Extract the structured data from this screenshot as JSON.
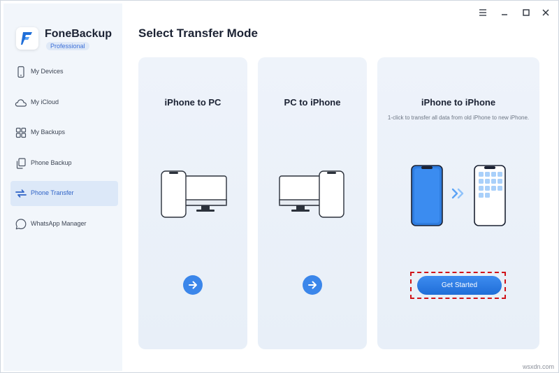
{
  "app": {
    "name": "FoneBackup",
    "tier": "Professional"
  },
  "sidebar": {
    "items": [
      {
        "label": "My Devices",
        "icon": "phone-icon",
        "active": false
      },
      {
        "label": "My iCloud",
        "icon": "cloud-icon",
        "active": false
      },
      {
        "label": "My Backups",
        "icon": "grid-icon",
        "active": false
      },
      {
        "label": "Phone Backup",
        "icon": "copy-icon",
        "active": false
      },
      {
        "label": "Phone Transfer",
        "icon": "transfer-icon",
        "active": true
      },
      {
        "label": "WhatsApp Manager",
        "icon": "whatsapp-icon",
        "active": false
      }
    ]
  },
  "window_controls": [
    "menu-icon",
    "minimize-icon",
    "maximize-icon",
    "close-icon"
  ],
  "main": {
    "title": "Select Transfer Mode",
    "cards": [
      {
        "title": "iPhone to PC",
        "description": "",
        "action": "arrow-right-icon"
      },
      {
        "title": "PC to iPhone",
        "description": "",
        "action": "arrow-right-icon"
      },
      {
        "title": "iPhone to iPhone",
        "description": "1-click to transfer all data from old iPhone to new iPhone.",
        "action_label": "Get Started"
      }
    ]
  },
  "watermark": "wsxdn.com",
  "colors": {
    "accent": "#3b86ea",
    "sidebar_bg": "#f2f6fb",
    "card_bg": "#eef3fa",
    "highlight": "#d0141a"
  }
}
